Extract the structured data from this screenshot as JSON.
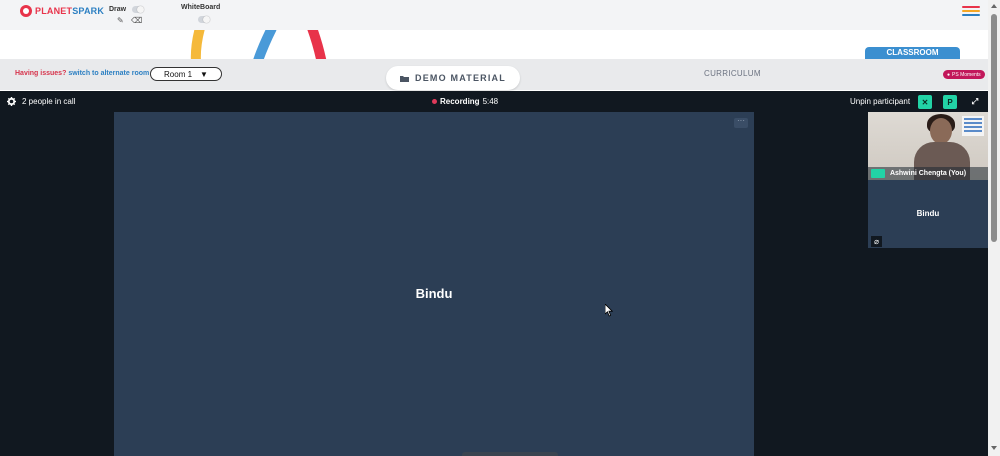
{
  "brand": {
    "logo_part1": "PLANET",
    "logo_part2": "SPARK"
  },
  "toolbar": {
    "draw_label": "Draw",
    "whiteboard_label": "WhiteBoard",
    "draw_on": false,
    "whiteboard_on": false
  },
  "menu": {
    "colors": [
      "#e8334a",
      "#f5a623",
      "#2b7fc2"
    ]
  },
  "controls": {
    "issues_question": "Having issues?",
    "issues_link": "switch to alternate room",
    "room_value": "Room 1",
    "demo_material_label": "DEMO MATERIAL",
    "curriculum_label": "CURRICULUM",
    "classroom_label": "CLASSROOM",
    "ps_moments_label": "PS Moments"
  },
  "call": {
    "people_count_text": "2 people in call",
    "recording_label": "Recording",
    "recording_time": "5:48",
    "unpin_label": "Unpin participant",
    "pin_letter": "P",
    "main_participant": "Bindu",
    "self_participant": "Ashwini Chengta (You)",
    "other_participant": "Bindu"
  },
  "colors": {
    "accent_green": "#22d3a6",
    "recording_red": "#e03a5a",
    "tile_bg": "#2c3e55",
    "call_bg": "#111820",
    "brand_red": "#e8334a",
    "brand_blue": "#2b7fc2"
  }
}
